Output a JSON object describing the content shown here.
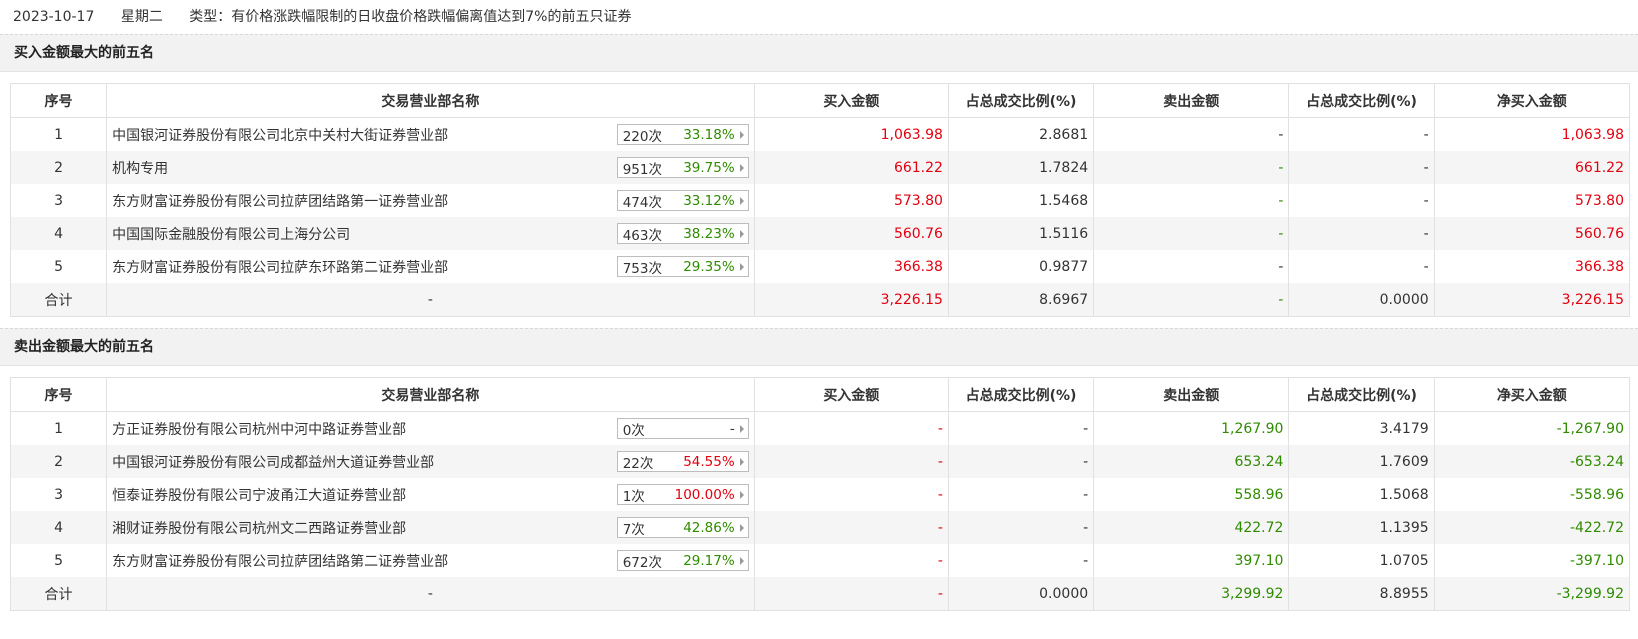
{
  "header": {
    "date": "2023-10-17",
    "weekday": "星期二",
    "type_text": "类型：有价格涨跌幅限制的日收盘价格跌幅偏离值达到7%的前五只证券"
  },
  "columns": [
    "序号",
    "交易营业部名称",
    "买入金额",
    "占总成交比例(%)",
    "卖出金额",
    "占总成交比例(%)",
    "净买入金额"
  ],
  "colors": {
    "up": "#e4000f",
    "down": "#2f8b00"
  },
  "buy_section": {
    "title": "买入金额最大的前五名",
    "rows": [
      {
        "no": "1",
        "name": "中国银河证券股份有限公司北京中关村大街证券营业部",
        "times": "220次",
        "rate": "33.18%",
        "rate_color": "green",
        "buy": "1,063.98",
        "buy_color": "red",
        "buy_pct": "2.8681",
        "sell": "-",
        "sell_color": "",
        "sell_pct": "-",
        "net": "1,063.98",
        "net_color": "red"
      },
      {
        "no": "2",
        "name": "机构专用",
        "times": "951次",
        "rate": "39.75%",
        "rate_color": "green",
        "buy": "661.22",
        "buy_color": "red",
        "buy_pct": "1.7824",
        "sell": "-",
        "sell_color": "green",
        "sell_pct": "-",
        "net": "661.22",
        "net_color": "red"
      },
      {
        "no": "3",
        "name": "东方财富证券股份有限公司拉萨团结路第一证券营业部",
        "times": "474次",
        "rate": "33.12%",
        "rate_color": "green",
        "buy": "573.80",
        "buy_color": "red",
        "buy_pct": "1.5468",
        "sell": "-",
        "sell_color": "green",
        "sell_pct": "-",
        "net": "573.80",
        "net_color": "red"
      },
      {
        "no": "4",
        "name": "中国国际金融股份有限公司上海分公司",
        "times": "463次",
        "rate": "38.23%",
        "rate_color": "green",
        "buy": "560.76",
        "buy_color": "red",
        "buy_pct": "1.5116",
        "sell": "-",
        "sell_color": "green",
        "sell_pct": "-",
        "net": "560.76",
        "net_color": "red"
      },
      {
        "no": "5",
        "name": "东方财富证券股份有限公司拉萨东环路第二证券营业部",
        "times": "753次",
        "rate": "29.35%",
        "rate_color": "green",
        "buy": "366.38",
        "buy_color": "red",
        "buy_pct": "0.9877",
        "sell": "-",
        "sell_color": "",
        "sell_pct": "-",
        "net": "366.38",
        "net_color": "red"
      }
    ],
    "total": {
      "label": "合计",
      "name": "-",
      "buy": "3,226.15",
      "buy_color": "red",
      "buy_pct": "8.6967",
      "sell": "-",
      "sell_color": "green",
      "sell_pct": "0.0000",
      "net": "3,226.15",
      "net_color": "red"
    }
  },
  "sell_section": {
    "title": "卖出金额最大的前五名",
    "rows": [
      {
        "no": "1",
        "name": "方正证券股份有限公司杭州中河中路证券营业部",
        "times": "0次",
        "rate": "-",
        "rate_color": "",
        "buy": "-",
        "buy_color": "red",
        "buy_pct": "-",
        "sell": "1,267.90",
        "sell_color": "green",
        "sell_pct": "3.4179",
        "net": "-1,267.90",
        "net_color": "green"
      },
      {
        "no": "2",
        "name": "中国银河证券股份有限公司成都益州大道证券营业部",
        "times": "22次",
        "rate": "54.55%",
        "rate_color": "red",
        "buy": "-",
        "buy_color": "red",
        "buy_pct": "-",
        "sell": "653.24",
        "sell_color": "green",
        "sell_pct": "1.7609",
        "net": "-653.24",
        "net_color": "green"
      },
      {
        "no": "3",
        "name": "恒泰证券股份有限公司宁波甬江大道证券营业部",
        "times": "1次",
        "rate": "100.00%",
        "rate_color": "red",
        "buy": "-",
        "buy_color": "red",
        "buy_pct": "-",
        "sell": "558.96",
        "sell_color": "green",
        "sell_pct": "1.5068",
        "net": "-558.96",
        "net_color": "green"
      },
      {
        "no": "4",
        "name": "湘财证券股份有限公司杭州文二西路证券营业部",
        "times": "7次",
        "rate": "42.86%",
        "rate_color": "green",
        "buy": "-",
        "buy_color": "red",
        "buy_pct": "-",
        "sell": "422.72",
        "sell_color": "green",
        "sell_pct": "1.1395",
        "net": "-422.72",
        "net_color": "green"
      },
      {
        "no": "5",
        "name": "东方财富证券股份有限公司拉萨团结路第二证券营业部",
        "times": "672次",
        "rate": "29.17%",
        "rate_color": "green",
        "buy": "-",
        "buy_color": "red",
        "buy_pct": "-",
        "sell": "397.10",
        "sell_color": "green",
        "sell_pct": "1.0705",
        "net": "-397.10",
        "net_color": "green"
      }
    ],
    "total": {
      "label": "合计",
      "name": "-",
      "buy": "-",
      "buy_color": "red",
      "buy_pct": "0.0000",
      "sell": "3,299.92",
      "sell_color": "green",
      "sell_pct": "8.8955",
      "net": "-3,299.92",
      "net_color": "green"
    }
  }
}
